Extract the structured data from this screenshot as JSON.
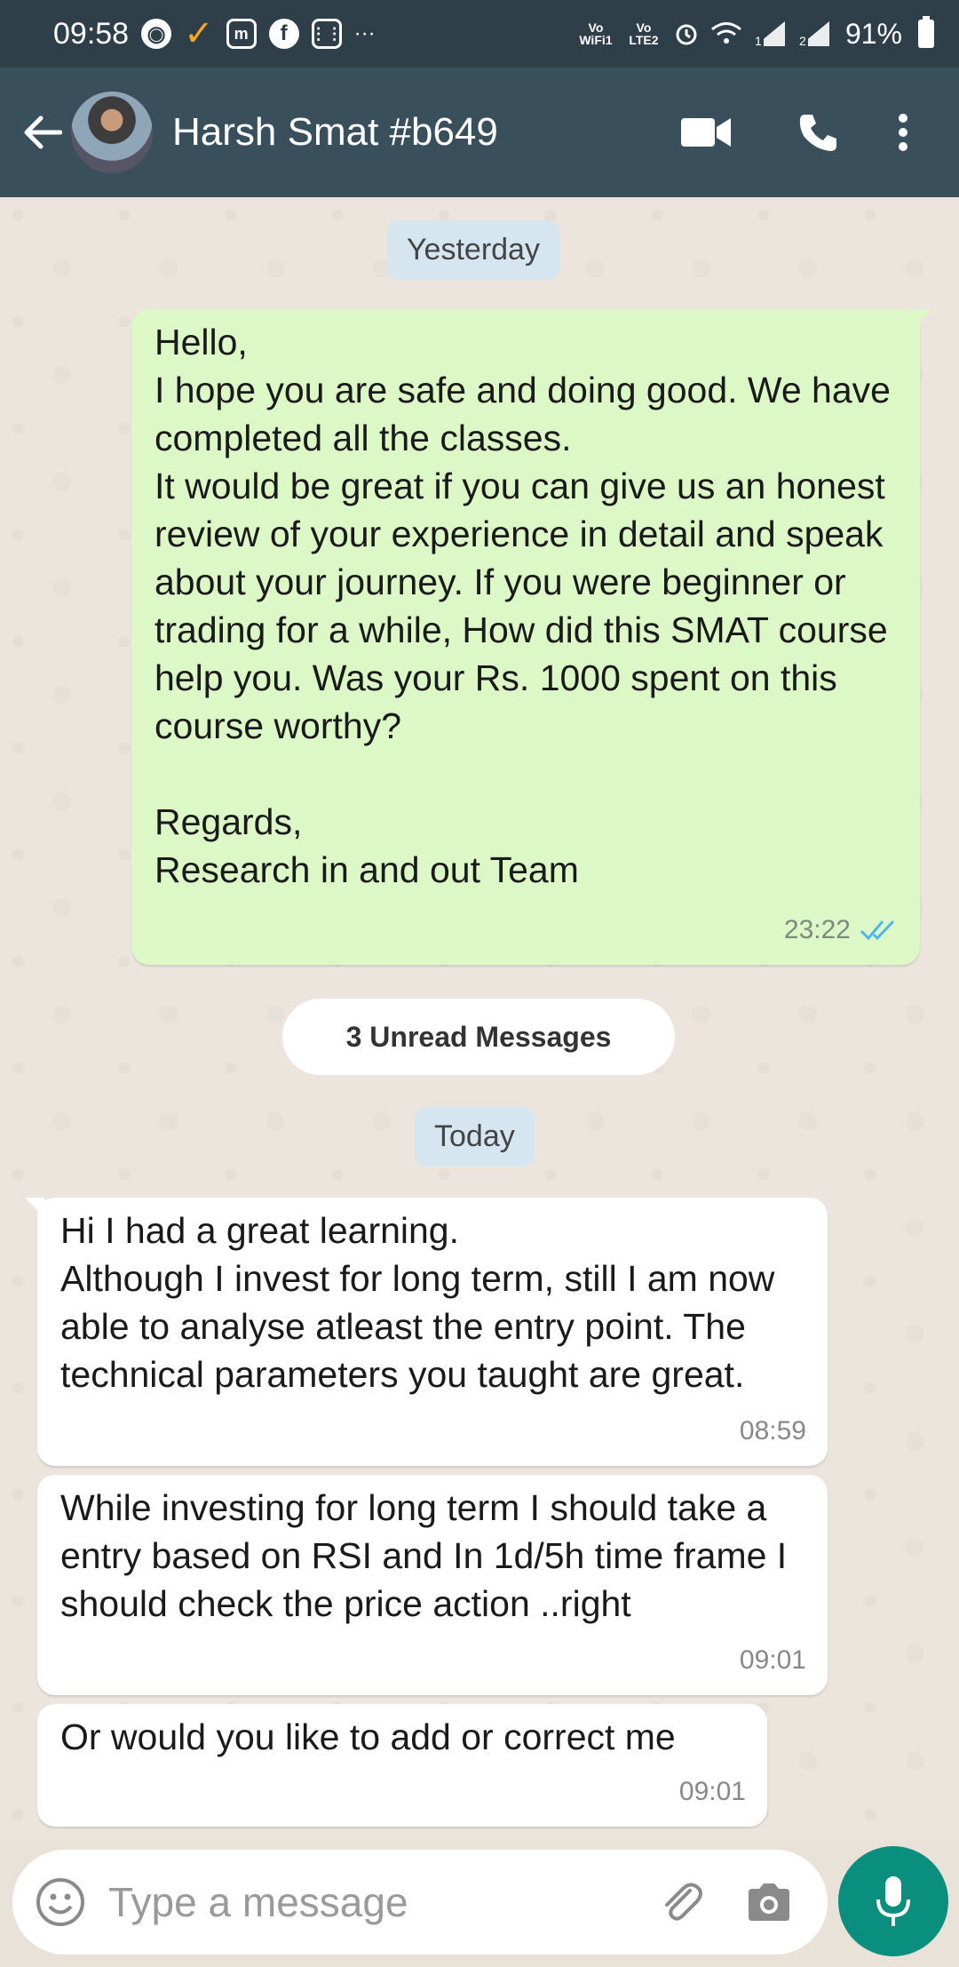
{
  "status_bar": {
    "time": "09:58",
    "battery_percent": "91%",
    "network_labels": [
      "Vo WiFi1",
      "Vo LTE2"
    ],
    "sim1": "1",
    "sim2": "2",
    "icons": [
      "app-notification-icon",
      "check-icon",
      "m-icon",
      "facebook-icon",
      "calculator-icon",
      "more-icon",
      "alarm-icon",
      "wifi-icon",
      "signal-icon",
      "signal-icon",
      "battery-icon"
    ]
  },
  "header": {
    "contact_name": "Harsh Smat #b649"
  },
  "chat": {
    "date_yesterday": "Yesterday",
    "date_today": "Today",
    "unread_label": "3 Unread Messages",
    "messages": [
      {
        "direction": "out",
        "text": "Hello,\nI hope you are safe and doing good. We have completed all the classes.\nIt would be great if you can give us an honest review of your experience in detail and speak about your journey. If you were beginner or trading for a while, How did this SMAT course help you. Was your Rs. 1000 spent on this course worthy?\n\nRegards,\nResearch in and out Team",
        "time": "23:22",
        "status": "read"
      },
      {
        "direction": "in",
        "text": "Hi I had a great learning.\nAlthough I invest for long term, still I am now able to analyse atleast the entry point. The technical parameters you taught are great.",
        "time": "08:59"
      },
      {
        "direction": "in",
        "text": "While investing for long term I should take a entry based on RSI and In 1d/5h time frame I should check the price action ..right",
        "time": "09:01"
      },
      {
        "direction": "in",
        "text": "Or would you like to add or correct me",
        "time": "09:01"
      }
    ]
  },
  "input": {
    "placeholder": "Type a message"
  },
  "colors": {
    "header": "#3a4f5c",
    "status_bar": "#2f3f4a",
    "outgoing_bubble": "#dcf8c6",
    "incoming_bubble": "#ffffff",
    "mic_button": "#0a8f7f",
    "read_ticks": "#4fb6ec"
  }
}
